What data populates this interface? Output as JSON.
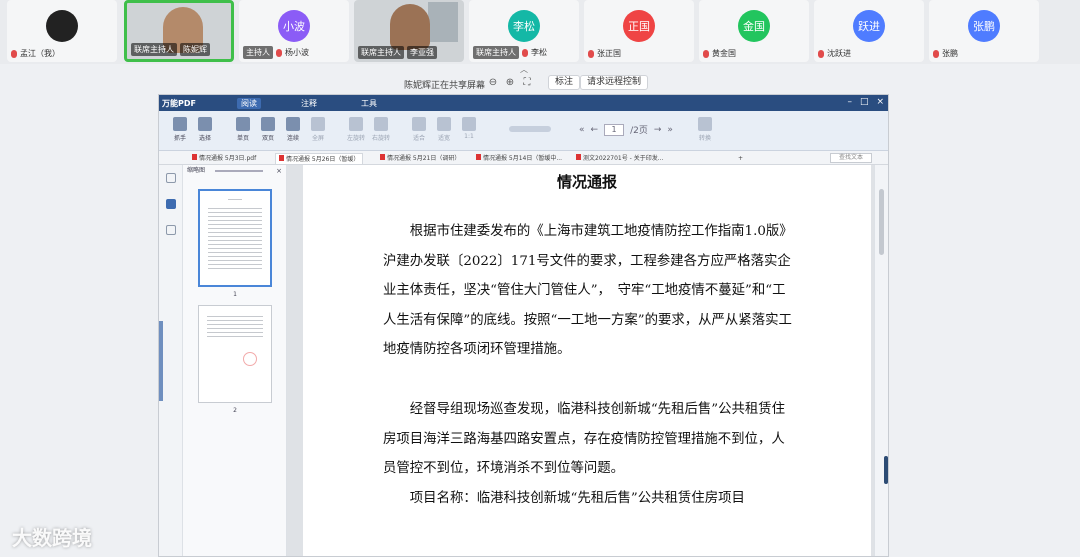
{
  "participants": [
    {
      "name": "孟江（我）",
      "avatar_text": "",
      "role": "",
      "style": "dark",
      "muted": true
    },
    {
      "name": "陈妮辉",
      "avatar_text": "",
      "role": "联席主持人",
      "style": "video",
      "muted": false
    },
    {
      "name": "杨小波",
      "avatar_text": "小波",
      "role": "主持人",
      "style": "purple",
      "muted": true
    },
    {
      "name": "李亚强",
      "avatar_text": "",
      "role": "联席主持人",
      "style": "video",
      "muted": false
    },
    {
      "name": "李松",
      "avatar_text": "李松",
      "role": "联席主持人",
      "style": "teal",
      "muted": true
    },
    {
      "name": "张正国",
      "avatar_text": "正国",
      "role": "",
      "style": "red",
      "muted": true
    },
    {
      "name": "黄金国",
      "avatar_text": "金国",
      "role": "",
      "style": "green",
      "muted": true
    },
    {
      "name": "沈跃进",
      "avatar_text": "跃进",
      "role": "",
      "style": "blue",
      "muted": true
    },
    {
      "name": "张鹏",
      "avatar_text": "张鹏",
      "role": "",
      "style": "blue",
      "muted": true
    }
  ],
  "share_bar": {
    "status": "陈妮辉正在共享屏幕",
    "annotate_label": "标注",
    "remote_control_label": "请求远程控制"
  },
  "pdf_app": {
    "app_name": "万能PDF",
    "mode_tabs": [
      "阅读",
      "注释",
      "工具"
    ],
    "toolbar": [
      "抓手",
      "选择",
      "单页",
      "双页",
      "连续",
      "全屏",
      "左旋转",
      "右旋转",
      "适合",
      "适宽",
      "1:1",
      "",
      "",
      "",
      "",
      "",
      "",
      "",
      "",
      "",
      "转换"
    ],
    "page_current": "1",
    "page_total": "/2页",
    "doc_tabs": [
      "情况通报 5月3日.pdf",
      "情况通报 5月26日（暂缓）",
      "情况通报 5月21日（调研）",
      "情况通报 5月14日（暂缓中...",
      "测文2022701号 - 关于印发..."
    ],
    "search_placeholder": "查找文本",
    "thumb_header": "缩略图",
    "thumb_pages": [
      "1",
      "2"
    ]
  },
  "document": {
    "title": "情况通报",
    "paragraphs": [
      "根据市住建委发布的《上海市建筑工地疫情防控工作指南1.0版》沪建办发联〔2022〕171号文件的要求，工程参建各方应严格落实企业主体责任，坚决“管住大门管住人”，　守牢“工地疫情不蔓延”和“工人生活有保障”的底线。按照“一工地一方案”的要求，从严从紧落实工地疫情防控各项闭环管理措施。",
      "经督导组现场巡查发现，临港科技创新城“先租后售”公共租赁住房项目海洋三路海基四路安置点，存在疫情防控管理措施不到位，人员管控不到位，环境消杀不到位等问题。",
      "项目名称：临港科技创新城“先租后售”公共租赁住房项目"
    ]
  },
  "watermark": "大数跨境",
  "colors": {
    "titlebar": "#2a4d80",
    "active_speaker": "#3fbf4a",
    "muted": "#e14b4b"
  }
}
